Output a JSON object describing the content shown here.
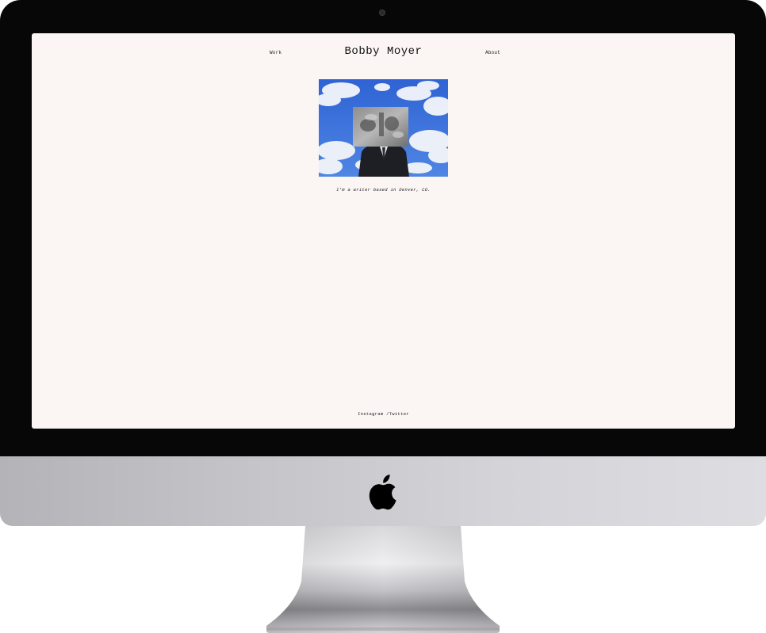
{
  "site": {
    "title": "Bobby Moyer",
    "nav": {
      "work": "Work",
      "about": "About"
    },
    "tagline": "I'm a writer based in Denver, CO.",
    "footer": {
      "instagram": "Instagram",
      "separator": " /",
      "twitter": "Twitter"
    }
  },
  "hero_image": {
    "alt": "Collage of a man in a suit whose head is replaced by a vintage photograph, against a blue sky with clouds"
  },
  "colors": {
    "screen_background": "#fbf5f4",
    "sky_blue": "#3c6fd6",
    "bezel": "#070707"
  },
  "icons": {
    "device_logo": "apple-logo-icon",
    "camera": "camera-icon"
  }
}
